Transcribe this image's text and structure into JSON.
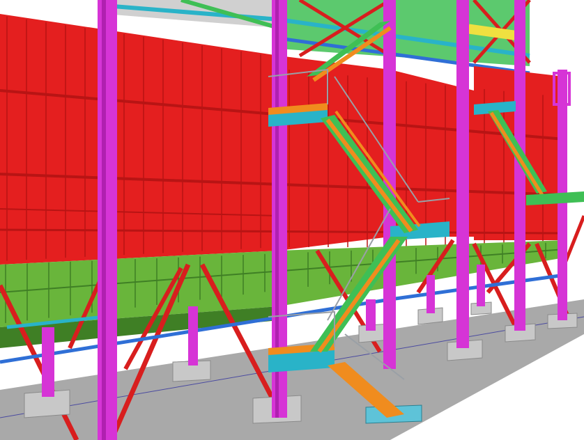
{
  "scene": {
    "subject": "3d-steel-structure-model",
    "colors": {
      "background": "#ffffff",
      "cladding_red": "#e41f1f",
      "cladding_red_dark": "#b81414",
      "hopper_green": "#69b53b",
      "hopper_green_dark": "#3f7f25",
      "column_magenta": "#d634d6",
      "brace_red": "#d81e1e",
      "beam_blue": "#2f6fd6",
      "beam_cyan": "#29b3c8",
      "stair_orange": "#f08c1e",
      "handrail_gray": "#9aa0a6",
      "grating_green": "#3fbf55",
      "foundation_gray": "#c8c8c8",
      "slab_gray": "#a9a9a9",
      "highlight_yellow": "#f0e040"
    }
  }
}
